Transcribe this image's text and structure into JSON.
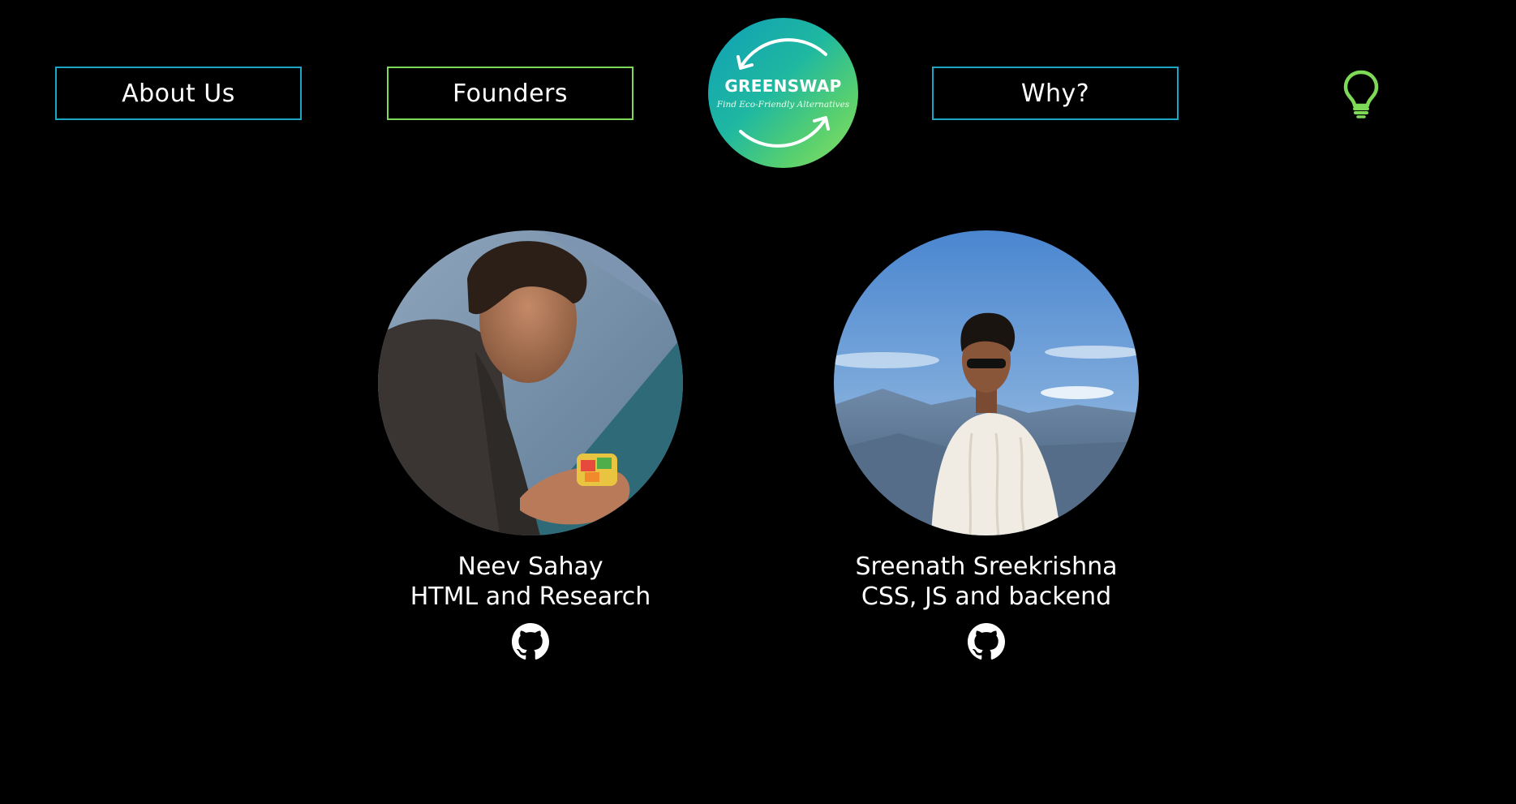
{
  "nav": {
    "about_label": "About Us",
    "founders_label": "Founders",
    "why_label": "Why?"
  },
  "logo": {
    "title": "GREENSWAP",
    "tagline": "Find Eco-Friendly Alternatives",
    "gradient_start": "#0f9fb8",
    "gradient_end": "#8ee063"
  },
  "theme": {
    "accent_blue": "#1aa6c4",
    "accent_green": "#7ed957",
    "background": "#000000"
  },
  "icons": {
    "idea": "lightbulb-icon",
    "github": "github-icon"
  },
  "founders": [
    {
      "name": "Neev Sahay",
      "role": "HTML and Research"
    },
    {
      "name": "Sreenath Sreekrishna",
      "role": "CSS, JS and backend"
    }
  ]
}
